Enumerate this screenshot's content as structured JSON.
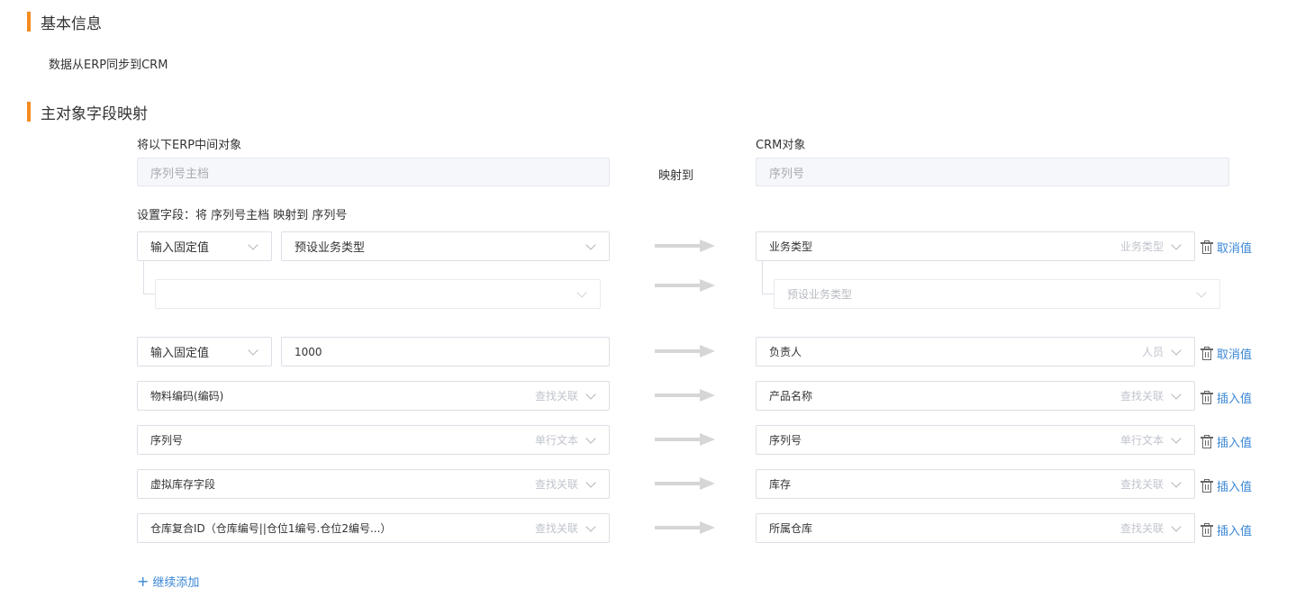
{
  "basic": {
    "title": "基本信息",
    "desc": "数据从ERP同步到CRM"
  },
  "mapping": {
    "title": "主对象字段映射",
    "src_label": "将以下ERP中间对象",
    "dst_label": "CRM对象",
    "src_object": "序列号主档",
    "map_to": "映射到",
    "dst_object": "序列号",
    "setting_text": "设置字段：将 序列号主档 映射到 序列号"
  },
  "rows": [
    {
      "src_type": "输入固定值",
      "src_value": "预设业务类型",
      "dst_field": "业务类型",
      "dst_hint": "业务类型",
      "action": "取消值",
      "sub_src": "",
      "sub_dst": "预设业务类型"
    },
    {
      "src_type": "输入固定值",
      "src_value": "1000",
      "dst_field": "负责人",
      "dst_hint": "人员",
      "action": "取消值"
    },
    {
      "src_field": "物料编码(编码)",
      "src_hint": "查找关联",
      "dst_field": "产品名称",
      "dst_hint": "查找关联",
      "action": "插入值"
    },
    {
      "src_field": "序列号",
      "src_hint": "单行文本",
      "dst_field": "序列号",
      "dst_hint": "单行文本",
      "action": "插入值"
    },
    {
      "src_field": "虚拟库存字段",
      "src_hint": "查找关联",
      "dst_field": "库存",
      "dst_hint": "查找关联",
      "action": "插入值"
    },
    {
      "src_field": "仓库复合ID（仓库编号||仓位1编号.仓位2编号...）",
      "src_hint": "查找关联",
      "dst_field": "所属仓库",
      "dst_hint": "查找关联",
      "action": "插入值"
    }
  ],
  "add_more": "继续添加",
  "colors": {
    "accent": "#f68b1f",
    "link": "#3b87d6"
  },
  "icons": [
    "trash-icon",
    "chevron-down-icon",
    "arrow-right-icon",
    "plus-icon"
  ]
}
